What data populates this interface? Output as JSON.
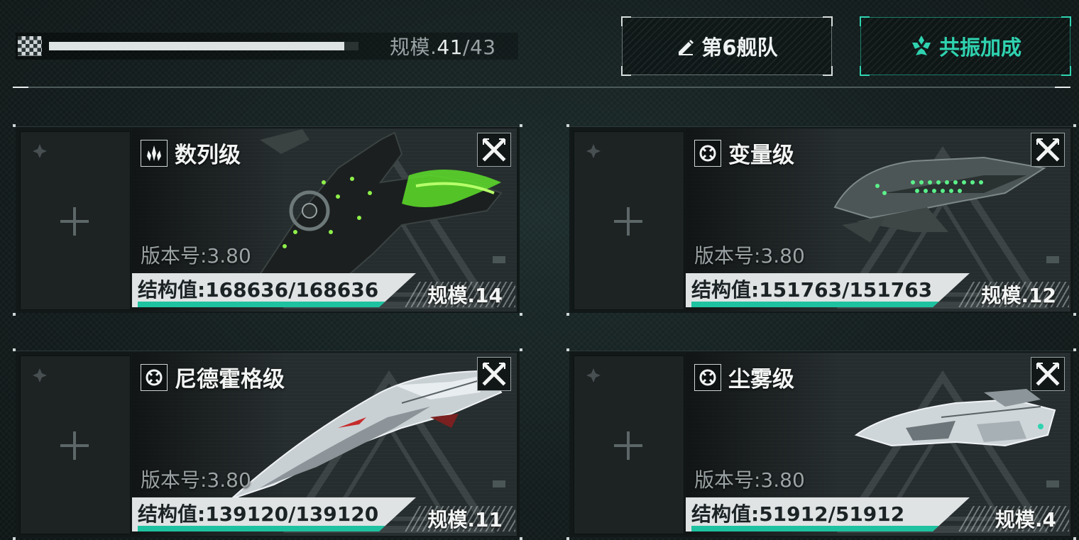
{
  "top": {
    "scale_label": "规模.",
    "scale_current": "41",
    "scale_max": "/43",
    "scale_fraction": 0.953,
    "fleet_button_label": "第6舰队",
    "resonance_button_label": "共振加成"
  },
  "colors": {
    "accent_teal": "#1fc2a0",
    "resonance_text": "#2fd3b0",
    "ship_green": "#7cf23a"
  },
  "ships": [
    {
      "class_name": "数列级",
      "type_icon": "crystal-icon",
      "version": "版本号:3.80",
      "structure": "结构值:168636/168636",
      "hp_fraction": 1.0,
      "scale": "规模.14"
    },
    {
      "class_name": "变量级",
      "type_icon": "target-icon",
      "version": "版本号:3.80",
      "structure": "结构值:151763/151763",
      "hp_fraction": 1.0,
      "scale": "规模.12"
    },
    {
      "class_name": "尼德霍格级",
      "type_icon": "target-icon",
      "version": "版本号:3.80",
      "structure": "结构值:139120/139120",
      "hp_fraction": 1.0,
      "scale": "规模.11"
    },
    {
      "class_name": "尘雾级",
      "type_icon": "target-icon",
      "version": "版本号:3.80",
      "structure": "结构值:51912/51912",
      "hp_fraction": 1.0,
      "scale": "规模.4"
    }
  ]
}
